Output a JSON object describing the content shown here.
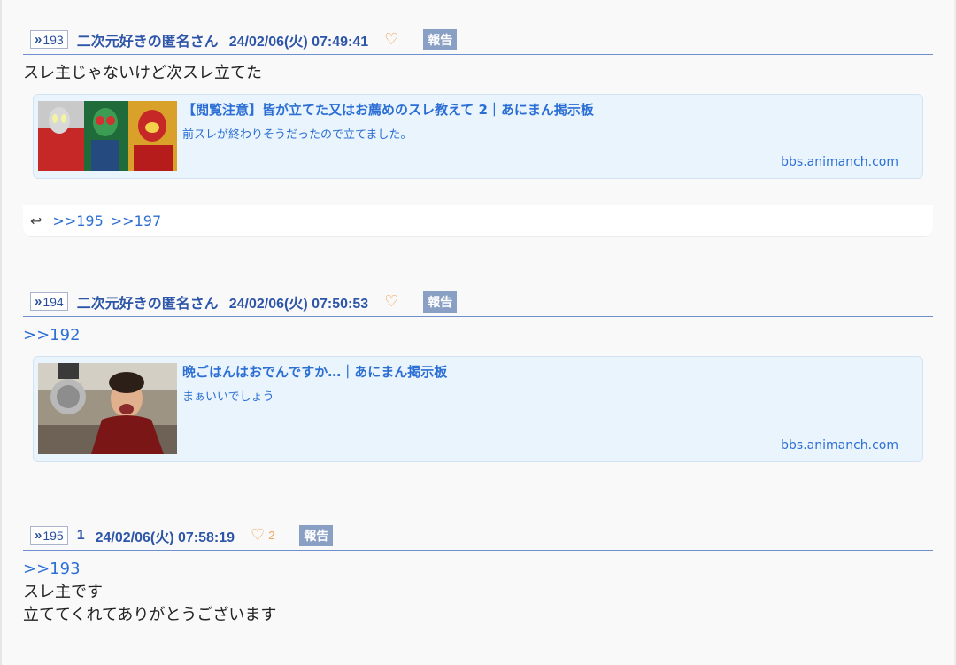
{
  "posts": [
    {
      "number": "193",
      "name": "二次元好きの匿名さん",
      "date": "24/02/06(火) 07:49:41",
      "likes": "",
      "report_label": "報告",
      "body": "スレ主じゃないけど次スレ立てた",
      "card": {
        "title": "【閲覧注意】皆が立てた又はお薦めのスレ教えて 2｜あにまん掲示板",
        "desc": "前スレが終わりそうだったので立てました。",
        "domain": "bbs.animanch.com"
      },
      "replies": [
        ">>195",
        ">>197"
      ]
    },
    {
      "number": "194",
      "name": "二次元好きの匿名さん",
      "date": "24/02/06(火) 07:50:53",
      "likes": "",
      "report_label": "報告",
      "anchor": ">>192",
      "card": {
        "title": "晩ごはんはおでんですか…｜あにまん掲示板",
        "desc": "まぁいいでしょう",
        "domain": "bbs.animanch.com"
      }
    },
    {
      "number": "195",
      "name": "1",
      "date": "24/02/06(火) 07:58:19",
      "likes": "2",
      "report_label": "報告",
      "anchor": ">>193",
      "body_lines": [
        "スレ主です",
        "立ててくれてありがとうございます"
      ]
    }
  ],
  "icons": {
    "resnum_chevron": "double-chevron-right-icon",
    "heart": "heart-outline-icon",
    "reply": "reply-arrow-icon"
  },
  "colors": {
    "link": "#2c6fd4",
    "name": "#2d55a8",
    "heart": "#f0a35a",
    "report_bg": "#8a9fc4",
    "card_bg": "#eaf4fd"
  }
}
